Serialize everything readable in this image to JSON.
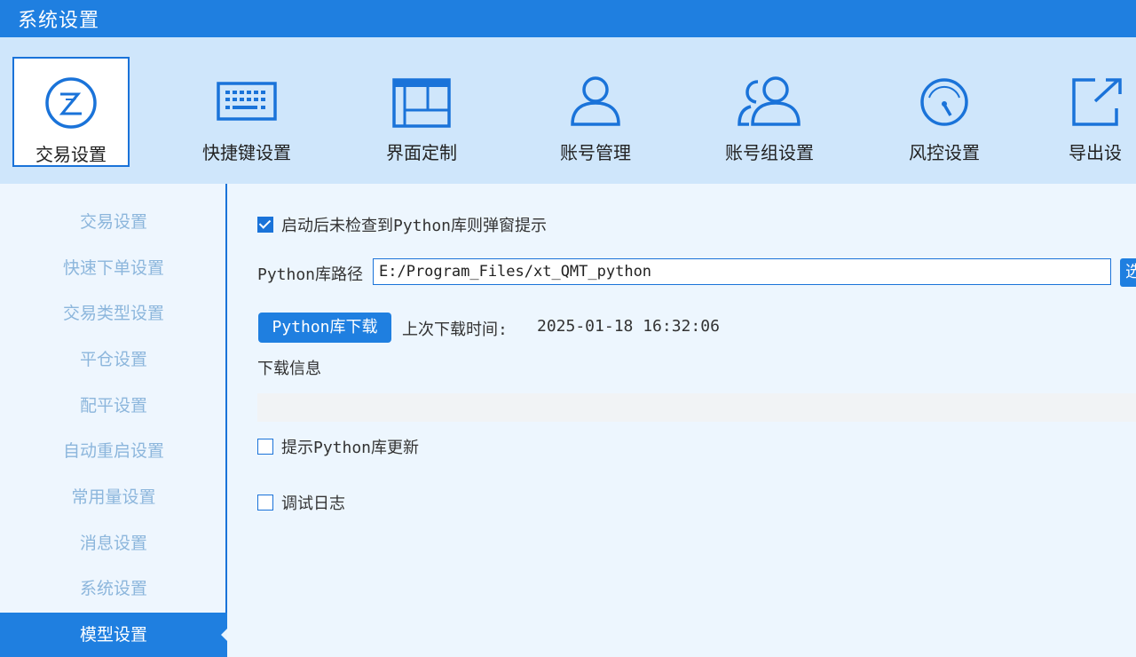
{
  "window": {
    "title": "系统设置"
  },
  "toolbar": {
    "items": [
      {
        "label": "交易设置",
        "icon": "trade-settings-icon",
        "active": true
      },
      {
        "label": "快捷键设置",
        "icon": "keyboard-icon"
      },
      {
        "label": "界面定制",
        "icon": "layout-icon"
      },
      {
        "label": "账号管理",
        "icon": "user-icon"
      },
      {
        "label": "账号组设置",
        "icon": "user-group-icon"
      },
      {
        "label": "风控设置",
        "icon": "gauge-icon"
      },
      {
        "label": "导出设",
        "icon": "export-icon"
      }
    ]
  },
  "sidebar": {
    "items": [
      {
        "label": "交易设置"
      },
      {
        "label": "快速下单设置"
      },
      {
        "label": "交易类型设置"
      },
      {
        "label": "平仓设置"
      },
      {
        "label": "配平设置"
      },
      {
        "label": "自动重启设置"
      },
      {
        "label": "常用量设置"
      },
      {
        "label": "消息设置"
      },
      {
        "label": "系统设置"
      },
      {
        "label": "模型设置",
        "active": true
      }
    ]
  },
  "main": {
    "popup_check": {
      "label": "启动后未检查到Python库则弹窗提示",
      "checked": true
    },
    "path_label": "Python库路径",
    "path_value": "E:/Program_Files/xt_QMT_python",
    "choose_button": "选",
    "download_button": "Python库下载",
    "last_download_label": "上次下载时间:",
    "last_download_time": "2025-01-18 16:32:06",
    "download_info_label": "下载信息",
    "download_progress": 0,
    "update_check": {
      "label": "提示Python库更新",
      "checked": false
    },
    "debug_check": {
      "label": "调试日志",
      "checked": false
    }
  },
  "colors": {
    "accent": "#1f7fe0",
    "toolbar_bg": "#cfe6fb",
    "nav_text": "#8cb6dc"
  }
}
